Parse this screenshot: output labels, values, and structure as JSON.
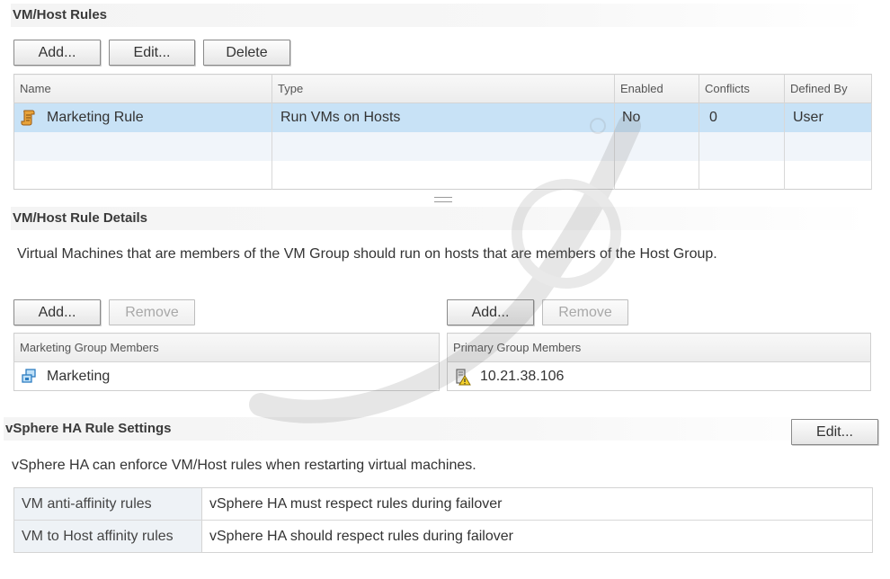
{
  "rules": {
    "title": "VM/Host Rules",
    "add_label": "Add...",
    "edit_label": "Edit...",
    "delete_label": "Delete",
    "columns": [
      "Name",
      "Type",
      "Enabled",
      "Conflicts",
      "Defined By"
    ],
    "rows": [
      {
        "name": "Marketing Rule",
        "type": "Run VMs on Hosts",
        "enabled": "No",
        "conflicts": "0",
        "defined_by": "User"
      }
    ]
  },
  "details": {
    "title": "VM/Host Rule Details",
    "description": "Virtual Machines that are members of the VM Group should run on hosts that are members of the Host Group.",
    "vm_group": {
      "add_label": "Add...",
      "remove_label": "Remove",
      "header": "Marketing Group Members",
      "members": [
        "Marketing"
      ]
    },
    "host_group": {
      "add_label": "Add...",
      "remove_label": "Remove",
      "header": "Primary Group Members",
      "members": [
        "10.21.38.106"
      ]
    }
  },
  "ha": {
    "title": "vSphere HA Rule Settings",
    "edit_label": "Edit...",
    "description": "vSphere HA can enforce VM/Host rules when restarting virtual machines.",
    "rows": [
      {
        "key": "VM anti-affinity rules",
        "value": "vSphere HA must respect rules during failover"
      },
      {
        "key": "VM to Host affinity rules",
        "value": "vSphere HA should respect rules during failover"
      }
    ]
  },
  "icons": {
    "rule": "scroll-icon",
    "vm_group": "vm-group-icon",
    "host": "host-warning-icon"
  },
  "colors": {
    "selected_row": "#c8e2f6",
    "header_bg": "#f4f4f4"
  }
}
